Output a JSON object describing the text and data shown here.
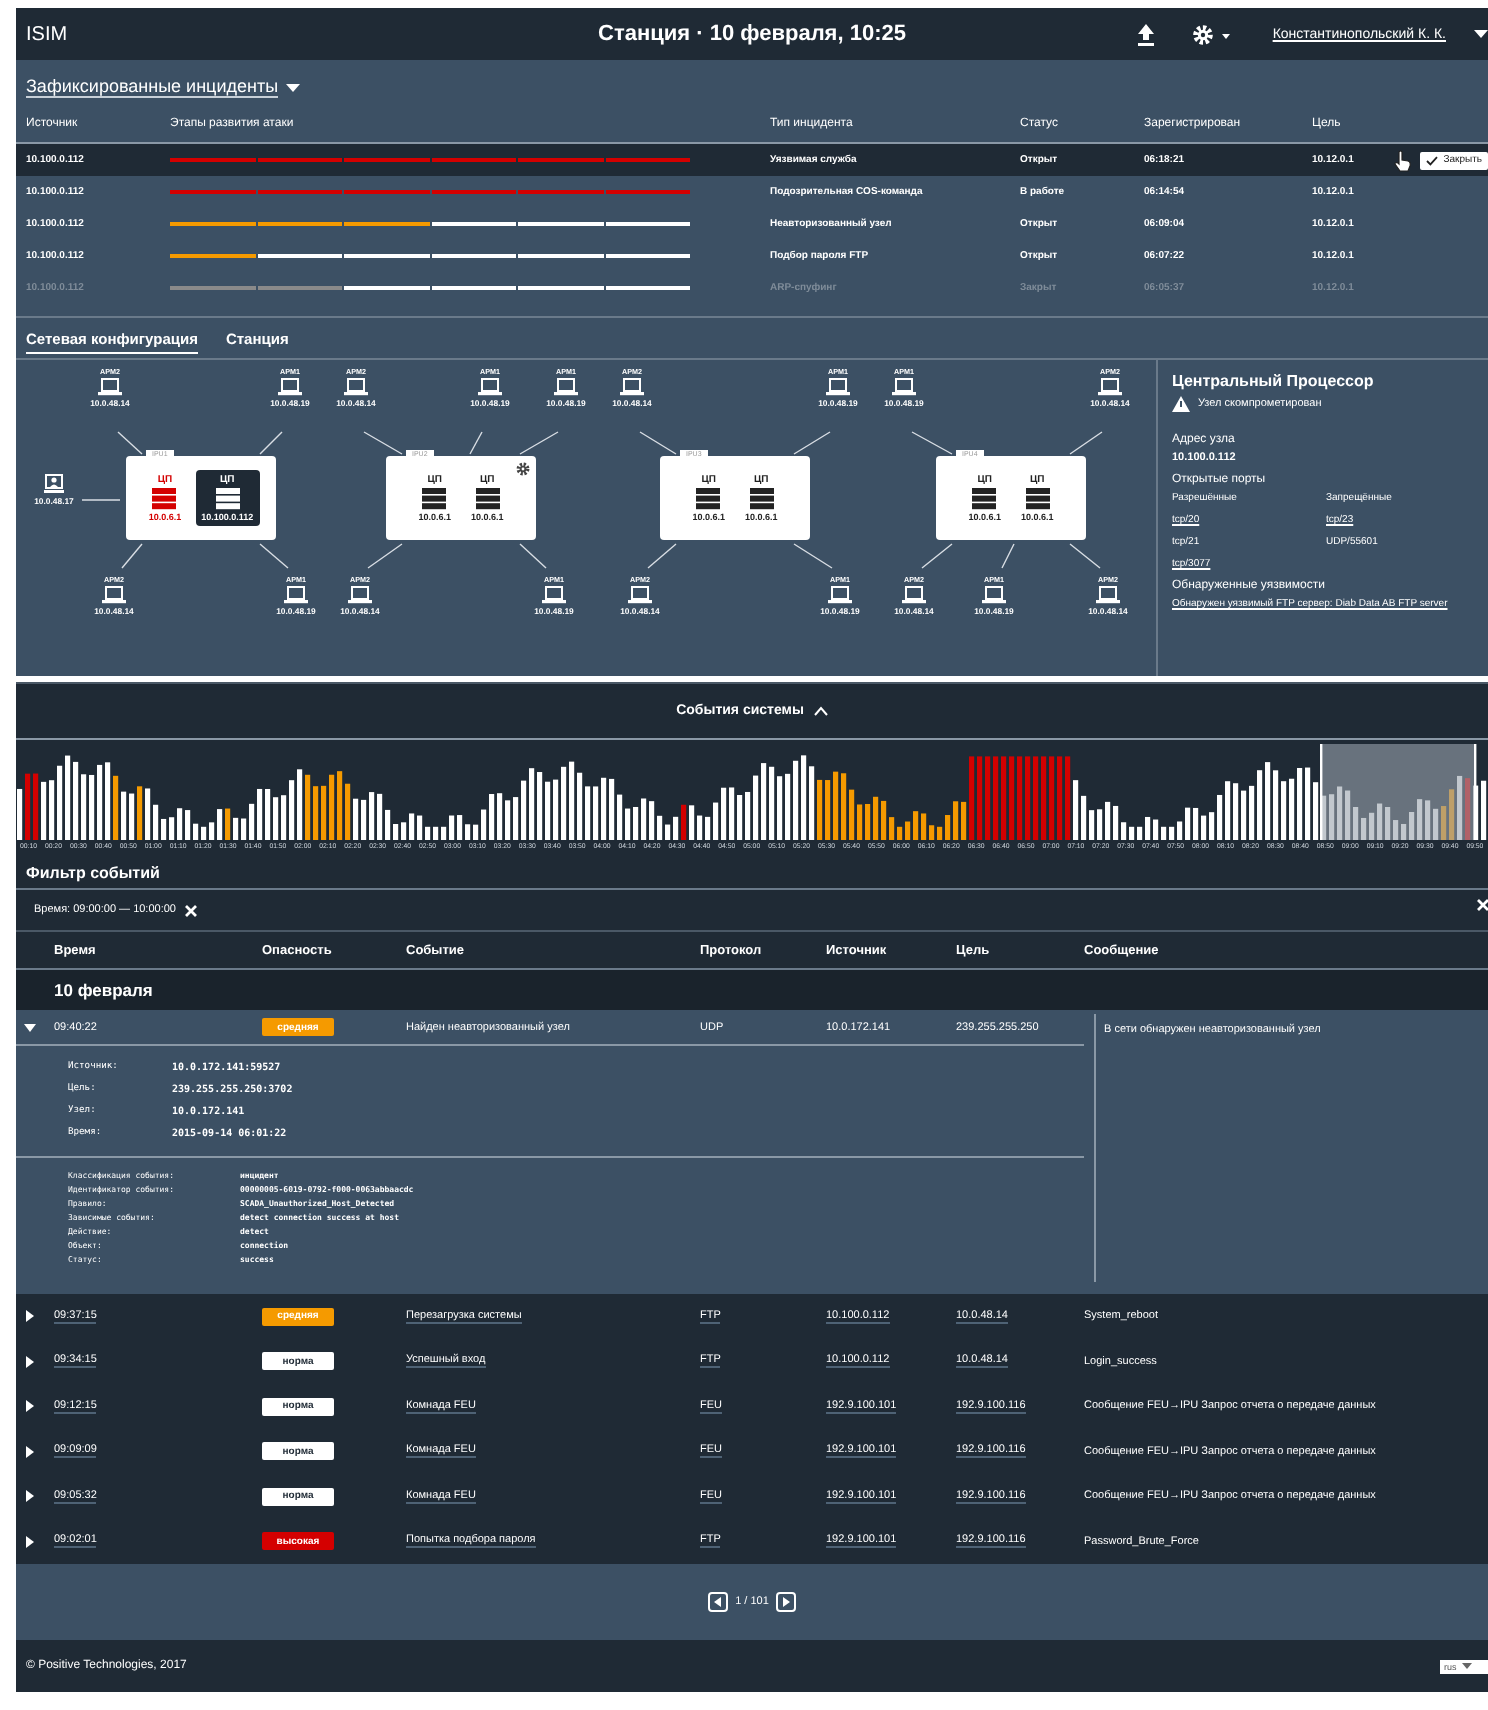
{
  "header": {
    "logo": "ISIM",
    "title": "Станция · 10 февраля, 10:25",
    "user": "Константинопольский К. К."
  },
  "incidents": {
    "title": "Зафиксированные инциденты",
    "columns": [
      "Источник",
      "Этапы развития атаки",
      "Тип инцидента",
      "Статус",
      "Зарегистрирован",
      "Цель"
    ],
    "rows": [
      {
        "source": "10.100.0.112",
        "stages": [
          {
            "color": "#d40000"
          },
          {
            "color": "#d40000"
          },
          {
            "color": "#d40000"
          },
          {
            "color": "#d40000"
          },
          {
            "color": "#d40000"
          },
          {
            "color": "#d40000"
          }
        ],
        "type": "Уязвимая служба",
        "status": "Открыт",
        "registered": "06:18:21",
        "target": "10.12.0.1",
        "selected": true,
        "disabled": false,
        "action": "Закрыть"
      },
      {
        "source": "10.100.0.112",
        "stages": [
          {
            "color": "#d40000"
          },
          {
            "color": "#d40000"
          },
          {
            "color": "#d40000"
          },
          {
            "color": "#d40000"
          },
          {
            "color": "#d40000"
          },
          {
            "color": "#d40000"
          }
        ],
        "type": "Подозрительная  COS-команда",
        "status": "В работе",
        "registered": "06:14:54",
        "target": "10.12.0.1",
        "selected": false,
        "disabled": false
      },
      {
        "source": "10.100.0.112",
        "stages": [
          {
            "color": "#f59a00"
          },
          {
            "color": "#f59a00"
          },
          {
            "color": "#f59a00"
          },
          {
            "color": "#ffffff"
          },
          {
            "color": "#ffffff"
          },
          {
            "color": "#ffffff"
          }
        ],
        "type": "Неавторизованный узел",
        "status": "Открыт",
        "registered": "06:09:04",
        "target": "10.12.0.1",
        "selected": false,
        "disabled": false
      },
      {
        "source": "10.100.0.112",
        "stages": [
          {
            "color": "#f59a00"
          },
          {
            "color": "#ffffff"
          },
          {
            "color": "#ffffff"
          },
          {
            "color": "#ffffff"
          },
          {
            "color": "#ffffff"
          },
          {
            "color": "#ffffff"
          }
        ],
        "type": "Подбор пароля FTP",
        "status": "Открыт",
        "registered": "06:07:22",
        "target": "10.12.0.1",
        "selected": false,
        "disabled": false
      },
      {
        "source": "10.100.0.112",
        "stages": [
          {
            "color": "#8a8a8a"
          },
          {
            "color": "#8a8a8a"
          },
          {
            "color": "#ffffff"
          },
          {
            "color": "#ffffff"
          },
          {
            "color": "#ffffff"
          },
          {
            "color": "#ffffff"
          }
        ],
        "type": "ARP-спуфинг",
        "status": "Закрыт",
        "registered": "06:05:37",
        "target": "10.12.0.1",
        "selected": false,
        "disabled": true
      }
    ]
  },
  "tabs": [
    {
      "label": "Сетевая конфигурация",
      "selected": true
    },
    {
      "label": "Станция",
      "selected": false
    }
  ],
  "network": {
    "operator": {
      "ip": "10.0.48.17"
    },
    "ipus": [
      {
        "label": "IPU1",
        "settings": false,
        "cpus": [
          {
            "label": "ЦП",
            "ip": "10.0.6.1",
            "compromised": true,
            "selected": false
          },
          {
            "label": "ЦП",
            "ip": "10.100.0.112",
            "compromised": false,
            "selected": true
          }
        ],
        "top": [
          {
            "label": "АРМ2",
            "ip": "10.0.48.14"
          },
          {
            "label": "АРМ1",
            "ip": "10.0.48.19"
          }
        ],
        "bottom": [
          {
            "label": "АРМ2",
            "ip": "10.0.48.14"
          },
          {
            "label": "АРМ1",
            "ip": "10.0.48.19"
          }
        ]
      },
      {
        "label": "IPU2",
        "settings": true,
        "cpus": [
          {
            "label": "ЦП",
            "ip": "10.0.6.1",
            "compromised": false,
            "selected": false
          },
          {
            "label": "ЦП",
            "ip": "10.0.6.1",
            "compromised": false,
            "selected": false
          }
        ],
        "top": [
          {
            "label": "АРМ2",
            "ip": "10.0.48.14"
          },
          {
            "label": "АРМ1",
            "ip": "10.0.48.19"
          },
          {
            "label": "АРМ1",
            "ip": "10.0.48.19"
          }
        ],
        "bottom": [
          {
            "label": "АРМ2",
            "ip": "10.0.48.14"
          },
          {
            "label": "АРМ1",
            "ip": "10.0.48.19"
          }
        ]
      },
      {
        "label": "IPU3",
        "settings": false,
        "cpus": [
          {
            "label": "ЦП",
            "ip": "10.0.6.1",
            "compromised": false,
            "selected": false
          },
          {
            "label": "ЦП",
            "ip": "10.0.6.1",
            "compromised": false,
            "selected": false
          }
        ],
        "top": [
          {
            "label": "АРМ2",
            "ip": "10.0.48.14"
          },
          {
            "label": "АРМ1",
            "ip": "10.0.48.19"
          }
        ],
        "bottom": [
          {
            "label": "АРМ2",
            "ip": "10.0.48.14"
          },
          {
            "label": "АРМ1",
            "ip": "10.0.48.19"
          }
        ]
      },
      {
        "label": "IPU4",
        "settings": false,
        "cpus": [
          {
            "label": "ЦП",
            "ip": "10.0.6.1",
            "compromised": false,
            "selected": false
          },
          {
            "label": "ЦП",
            "ip": "10.0.6.1",
            "compromised": false,
            "selected": false
          }
        ],
        "top": [
          {
            "label": "АРМ1",
            "ip": "10.0.48.19"
          },
          {
            "label": "АРМ2",
            "ip": "10.0.48.14"
          }
        ],
        "bottom": [
          {
            "label": "АРМ2",
            "ip": "10.0.48.14"
          },
          {
            "label": "АРМ1",
            "ip": "10.0.48.19"
          },
          {
            "label": "АРМ2",
            "ip": "10.0.48.14"
          }
        ]
      }
    ]
  },
  "node_panel": {
    "title": "Центральный Процессор",
    "alert": "Узел скомпрометирован",
    "address_label": "Адрес узла",
    "address": "10.100.0.112",
    "ports_label": "Открытые порты",
    "allowed_label": "Разрешённые",
    "forbidden_label": "Запрещённые",
    "allowed": [
      {
        "text": "tcp/20",
        "link": true
      },
      {
        "text": "tcp/21",
        "link": false
      },
      {
        "text": "tcp/3077",
        "link": true
      }
    ],
    "forbidden": [
      {
        "text": "tcp/23",
        "link": true
      },
      {
        "text": "UDP/55601",
        "link": false
      }
    ],
    "vuln_label": "Обнаруженные уязвимости",
    "vuln": "Обнаружен уязвимый FTP сервер: Diab Data AB FTP server"
  },
  "events_bar": {
    "title": "События системы",
    "time_labels": [
      "00:10",
      "00:20",
      "00:30",
      "00:40",
      "00:50",
      "01:00",
      "01:10",
      "01:20",
      "01:30",
      "01:40",
      "01:50",
      "02:00",
      "02:10",
      "02:20",
      "02:30",
      "02:40",
      "02:50",
      "03:00",
      "03:10",
      "03:20",
      "03:30",
      "03:40",
      "03:50",
      "04:00",
      "04:10",
      "04:20",
      "04:30",
      "04:40",
      "04:50",
      "05:00",
      "05:10",
      "05:20",
      "05:30",
      "05:40",
      "05:50",
      "06:00",
      "06:10",
      "06:20",
      "06:30",
      "06:40",
      "06:50",
      "07:00",
      "07:10",
      "07:20",
      "07:30",
      "07:40",
      "07:50",
      "08:00",
      "08:10",
      "08:20",
      "08:30",
      "08:40",
      "08:50",
      "09:00",
      "09:10",
      "09:20",
      "09:30",
      "09:40",
      "09:50"
    ]
  },
  "filter": {
    "title": "Фильтр событий",
    "chip": "Время: 09:00:00 — 10:00:00"
  },
  "events": {
    "columns": [
      "Время",
      "Опасность",
      "Событие",
      "Протокол",
      "Источник",
      "Цель",
      "Сообщение"
    ],
    "date": "10 февраля",
    "rows": [
      {
        "time": "09:40:22",
        "severity": "средняя",
        "kind": "medium",
        "event": "Найден неавторизованный узел",
        "protocol": "UDP",
        "source": "10.0.172.141",
        "target": "239.255.255.250",
        "message": "В сети обнаружен неавторизованный узел",
        "expanded": true,
        "fields": [
          {
            "label": "Источник:",
            "value": "10.0.172.141:59527"
          },
          {
            "label": "Цель:",
            "value": "239.255.255.250:3702"
          },
          {
            "label": "Узел:",
            "value": "10.0.172.141"
          },
          {
            "label": "Время:",
            "value": "2015-09-14  06:01:22"
          }
        ],
        "extra": [
          {
            "label": "Классификация события:",
            "value": "инцидент"
          },
          {
            "label": "Идентификатор события:",
            "value": "00000005-6019-0792-f000-0063abbaacdc"
          },
          {
            "label": "Правило:",
            "value": "SCADA_Unauthorized_Host_Detected"
          },
          {
            "label": "Зависимые события:",
            "value": "detect connection success at host"
          },
          {
            "label": "Действие:",
            "value": "detect"
          },
          {
            "label": "Объект:",
            "value": "connection"
          },
          {
            "label": "Статус:",
            "value": "success"
          }
        ]
      },
      {
        "time": "09:37:15",
        "severity": "средняя",
        "kind": "medium",
        "event": "Перезагрузка системы",
        "protocol": "FTP",
        "source": "10.100.0.112",
        "target": "10.0.48.14",
        "message": "System_reboot",
        "expanded": false
      },
      {
        "time": "09:34:15",
        "severity": "норма",
        "kind": "normal",
        "event": "Успешный вход",
        "protocol": "FTP",
        "source": "10.100.0.112",
        "target": "10.0.48.14",
        "message": "Login_success",
        "expanded": false
      },
      {
        "time": "09:12:15",
        "severity": "норма",
        "kind": "normal",
        "event": "Комнада FEU",
        "protocol": "FEU",
        "source": "192.9.100.101",
        "target": "192.9.100.116",
        "message": "Сообщение FEU→IPU Запрос отчета о передаче данных",
        "expanded": false
      },
      {
        "time": "09:09:09",
        "severity": "норма",
        "kind": "normal",
        "event": "Комнада FEU",
        "protocol": "FEU",
        "source": "192.9.100.101",
        "target": "192.9.100.116",
        "message": "Сообщение FEU→IPU Запрос отчета о передаче данных",
        "expanded": false
      },
      {
        "time": "09:05:32",
        "severity": "норма",
        "kind": "normal",
        "event": "Комнада FEU",
        "protocol": "FEU",
        "source": "192.9.100.101",
        "target": "192.9.100.116",
        "message": "Сообщение FEU→IPU Запрос отчета о передаче данных",
        "expanded": false
      },
      {
        "time": "09:02:01",
        "severity": "высокая",
        "kind": "high",
        "event": "Попытка подбора пароля",
        "protocol": "FTP",
        "source": "192.9.100.101",
        "target": "192.9.100.116",
        "message": "Password_Brute_Force",
        "expanded": false
      }
    ]
  },
  "pagination": {
    "text": "1 / 101"
  },
  "footer": {
    "copyright": "© Positive Technologies, 2017",
    "language": "rus"
  }
}
